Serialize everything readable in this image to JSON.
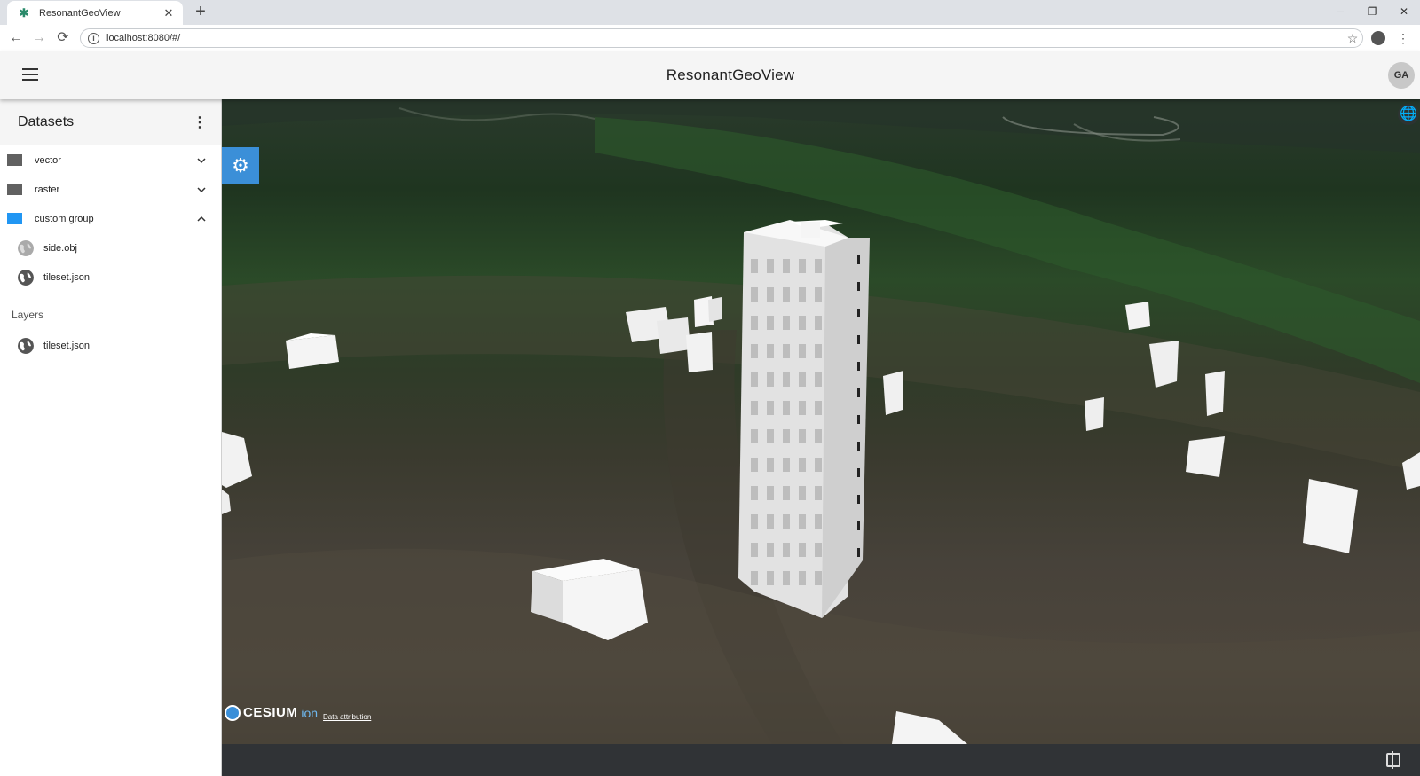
{
  "browser": {
    "tab_title": "ResonantGeoView",
    "tab_close": "✕",
    "new_tab": "+",
    "url": "localhost:8080/#/",
    "back": "←",
    "forward": "→",
    "reload": "⟳",
    "star": "☆",
    "menu": "⋮",
    "minimize": "─",
    "restore": "❐",
    "close": "✕"
  },
  "appbar": {
    "title": "ResonantGeoView",
    "avatar": "GA"
  },
  "sidebar": {
    "datasets_title": "Datasets",
    "datasets_menu": "⋮",
    "groups": [
      {
        "label": "vector",
        "expanded": false,
        "color": "#616161"
      },
      {
        "label": "raster",
        "expanded": false,
        "color": "#616161"
      },
      {
        "label": "custom group",
        "expanded": true,
        "color": "#2196f3"
      }
    ],
    "custom_group_files": [
      {
        "label": "side.obj",
        "icon": "globe-icon",
        "active": false
      },
      {
        "label": "tileset.json",
        "icon": "globe-icon",
        "active": true
      }
    ],
    "layers_title": "Layers",
    "layers": [
      {
        "label": "tileset.json",
        "icon": "globe-icon"
      }
    ]
  },
  "map": {
    "settings_icon": "⚙",
    "globe_icon": "🌐",
    "cesium_word": "CESIUM",
    "cesium_ion": "ion",
    "attribution": "Data attribution"
  },
  "colors": {
    "accent": "#2196f3",
    "cesium_blue": "#3b8fd8",
    "bottom_bar": "#303336"
  }
}
